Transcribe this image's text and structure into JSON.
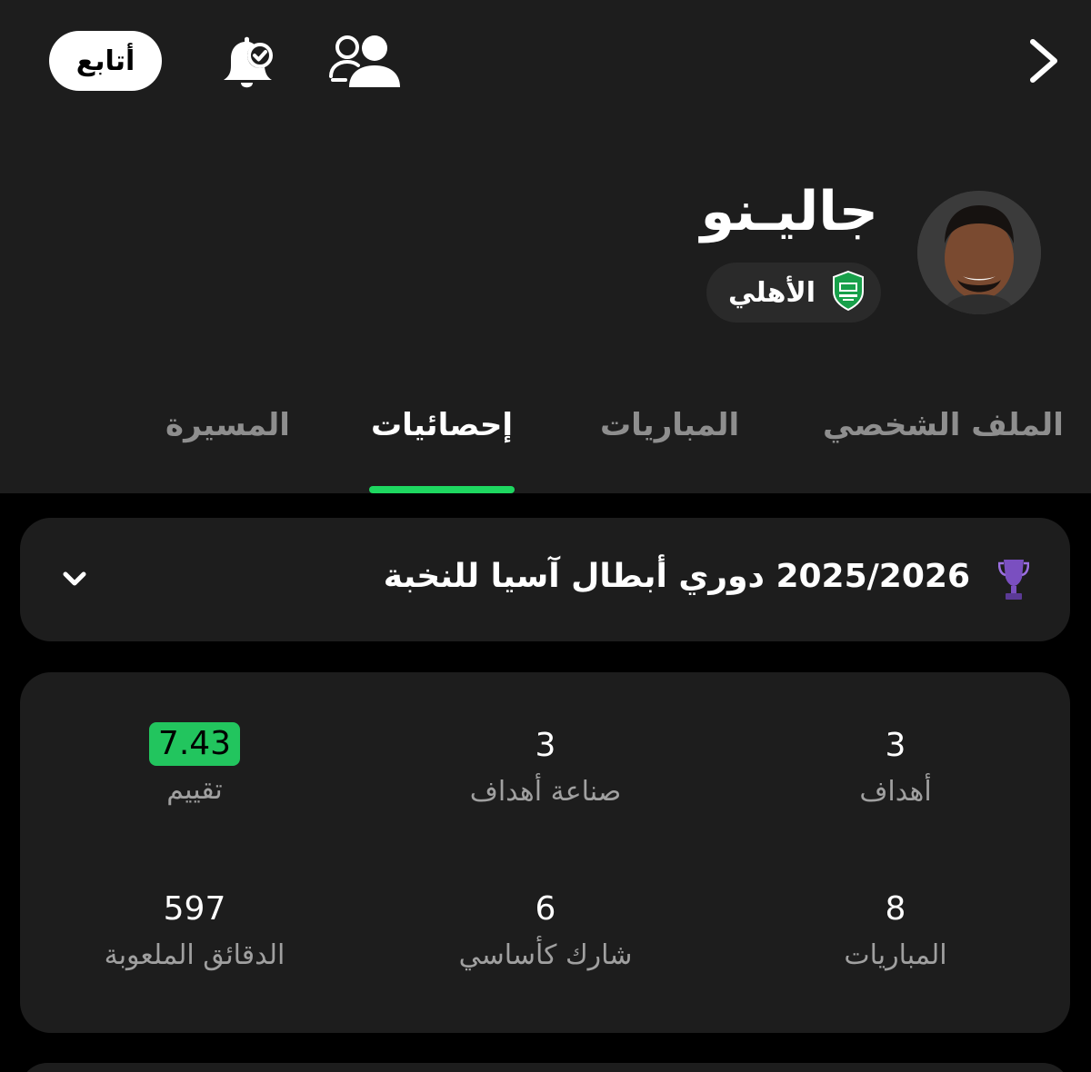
{
  "topbar": {
    "follow_label": "أتابع",
    "icons": [
      "bell-check-icon",
      "people-icon",
      "chevron-right-icon"
    ]
  },
  "player": {
    "name": "جاليـنو",
    "club": "الأهلي"
  },
  "tabs": [
    {
      "label": "الملف الشخصي",
      "active": false
    },
    {
      "label": "المباريات",
      "active": false
    },
    {
      "label": "إحصائيات",
      "active": true
    },
    {
      "label": "المسيرة",
      "active": false
    }
  ],
  "competition": {
    "title": "2025/2026 دوري أبطال آسيا للنخبة"
  },
  "stats": [
    {
      "value": "3",
      "label": "أهداف"
    },
    {
      "value": "3",
      "label": "صناعة أهداف"
    },
    {
      "value": "7.43",
      "label": "تقييم"
    },
    {
      "value": "8",
      "label": "المباريات"
    },
    {
      "value": "6",
      "label": "شارك كأساسي"
    },
    {
      "value": "597",
      "label": "الدقائق الملعوبة"
    }
  ],
  "colors": {
    "accent": "#1ed760",
    "rating_badge": "#22c55e",
    "card_bg": "#1d1d1d",
    "page_bg": "#000000"
  }
}
